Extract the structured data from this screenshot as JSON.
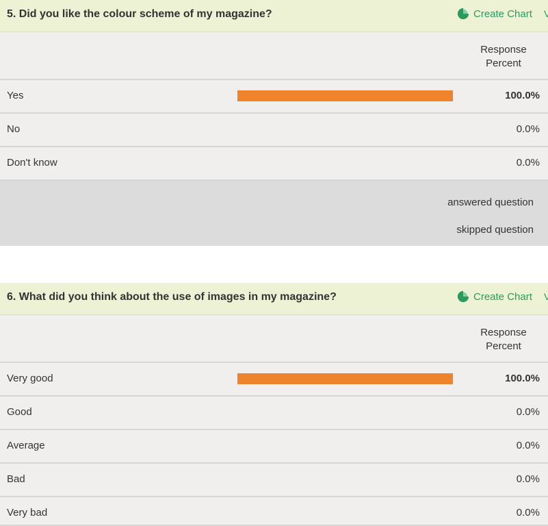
{
  "colors": {
    "bar": "#f0842c",
    "header_bg": "#eef2d4",
    "link": "#2b9a5f"
  },
  "icons": {
    "create_chart": "pie-chart-icon",
    "more": "chevron-down-icon"
  },
  "q5": {
    "title": "5. Did you like the colour scheme of my magazine?",
    "create_chart_label": "Create Chart",
    "more_label": "V",
    "column_header": "Response Percent",
    "rows": [
      {
        "label": "Yes",
        "percent": "100.0%",
        "fraction": 1.0
      },
      {
        "label": "No",
        "percent": "0.0%",
        "fraction": 0
      },
      {
        "label": "Don't know",
        "percent": "0.0%",
        "fraction": 0
      }
    ],
    "answered_label": "answered question",
    "skipped_label": "skipped question"
  },
  "q6": {
    "title": "6. What did you think about the use of images in my magazine?",
    "create_chart_label": "Create Chart",
    "more_label": "V",
    "column_header": "Response Percent",
    "rows": [
      {
        "label": "Very good",
        "percent": "100.0%",
        "fraction": 1.0
      },
      {
        "label": "Good",
        "percent": "0.0%",
        "fraction": 0
      },
      {
        "label": "Average",
        "percent": "0.0%",
        "fraction": 0
      },
      {
        "label": "Bad",
        "percent": "0.0%",
        "fraction": 0
      },
      {
        "label": "Very bad",
        "percent": "0.0%",
        "fraction": 0
      }
    ]
  }
}
